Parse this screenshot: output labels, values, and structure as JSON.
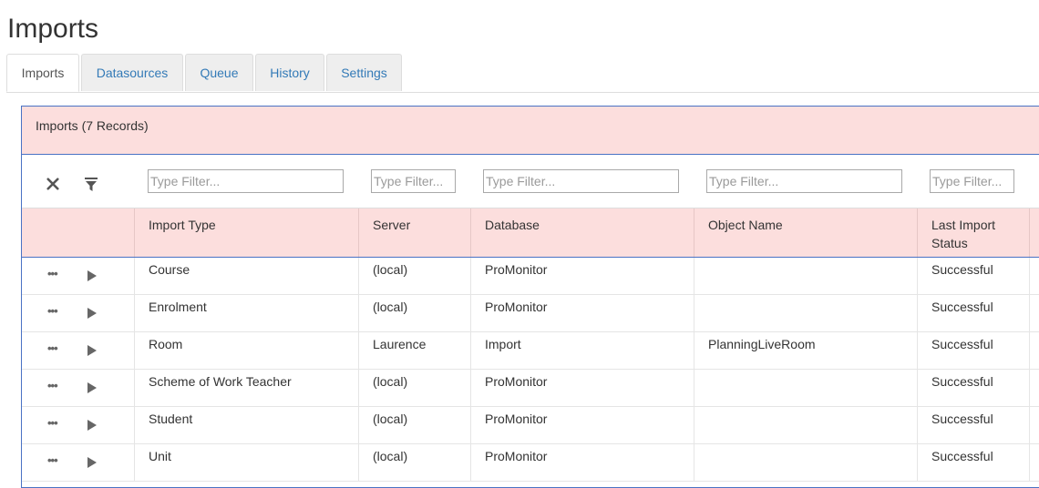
{
  "page": {
    "title": "Imports"
  },
  "tabs": [
    {
      "label": "Imports",
      "active": true
    },
    {
      "label": "Datasources",
      "active": false
    },
    {
      "label": "Queue",
      "active": false
    },
    {
      "label": "History",
      "active": false
    },
    {
      "label": "Settings",
      "active": false
    }
  ],
  "panel": {
    "title": "Imports (7 Records)"
  },
  "filters": {
    "placeholder": "Type Filter...",
    "clear_icon": "clear-x-icon",
    "filter_icon": "filter-funnel-icon"
  },
  "columns": [
    {
      "label": "Import Type"
    },
    {
      "label": "Server"
    },
    {
      "label": "Database"
    },
    {
      "label": "Object Name"
    },
    {
      "label": "Last Import Status"
    }
  ],
  "rows": [
    {
      "import_type": "Course",
      "server": "(local)",
      "database": "ProMonitor",
      "object_name": "",
      "status": "Successful"
    },
    {
      "import_type": "Enrolment",
      "server": "(local)",
      "database": "ProMonitor",
      "object_name": "",
      "status": "Successful"
    },
    {
      "import_type": "Room",
      "server": "Laurence",
      "database": "Import",
      "object_name": "PlanningLiveRoom",
      "status": "Successful"
    },
    {
      "import_type": "Scheme of Work Teacher",
      "server": "(local)",
      "database": "ProMonitor",
      "object_name": "",
      "status": "Successful"
    },
    {
      "import_type": "Student",
      "server": "(local)",
      "database": "ProMonitor",
      "object_name": "",
      "status": "Successful"
    },
    {
      "import_type": "Unit",
      "server": "(local)",
      "database": "ProMonitor",
      "object_name": "",
      "status": "Successful"
    }
  ],
  "colors": {
    "accent": "#337ab7",
    "header_bg": "#fcdedd",
    "panel_border": "#4a72c4"
  }
}
